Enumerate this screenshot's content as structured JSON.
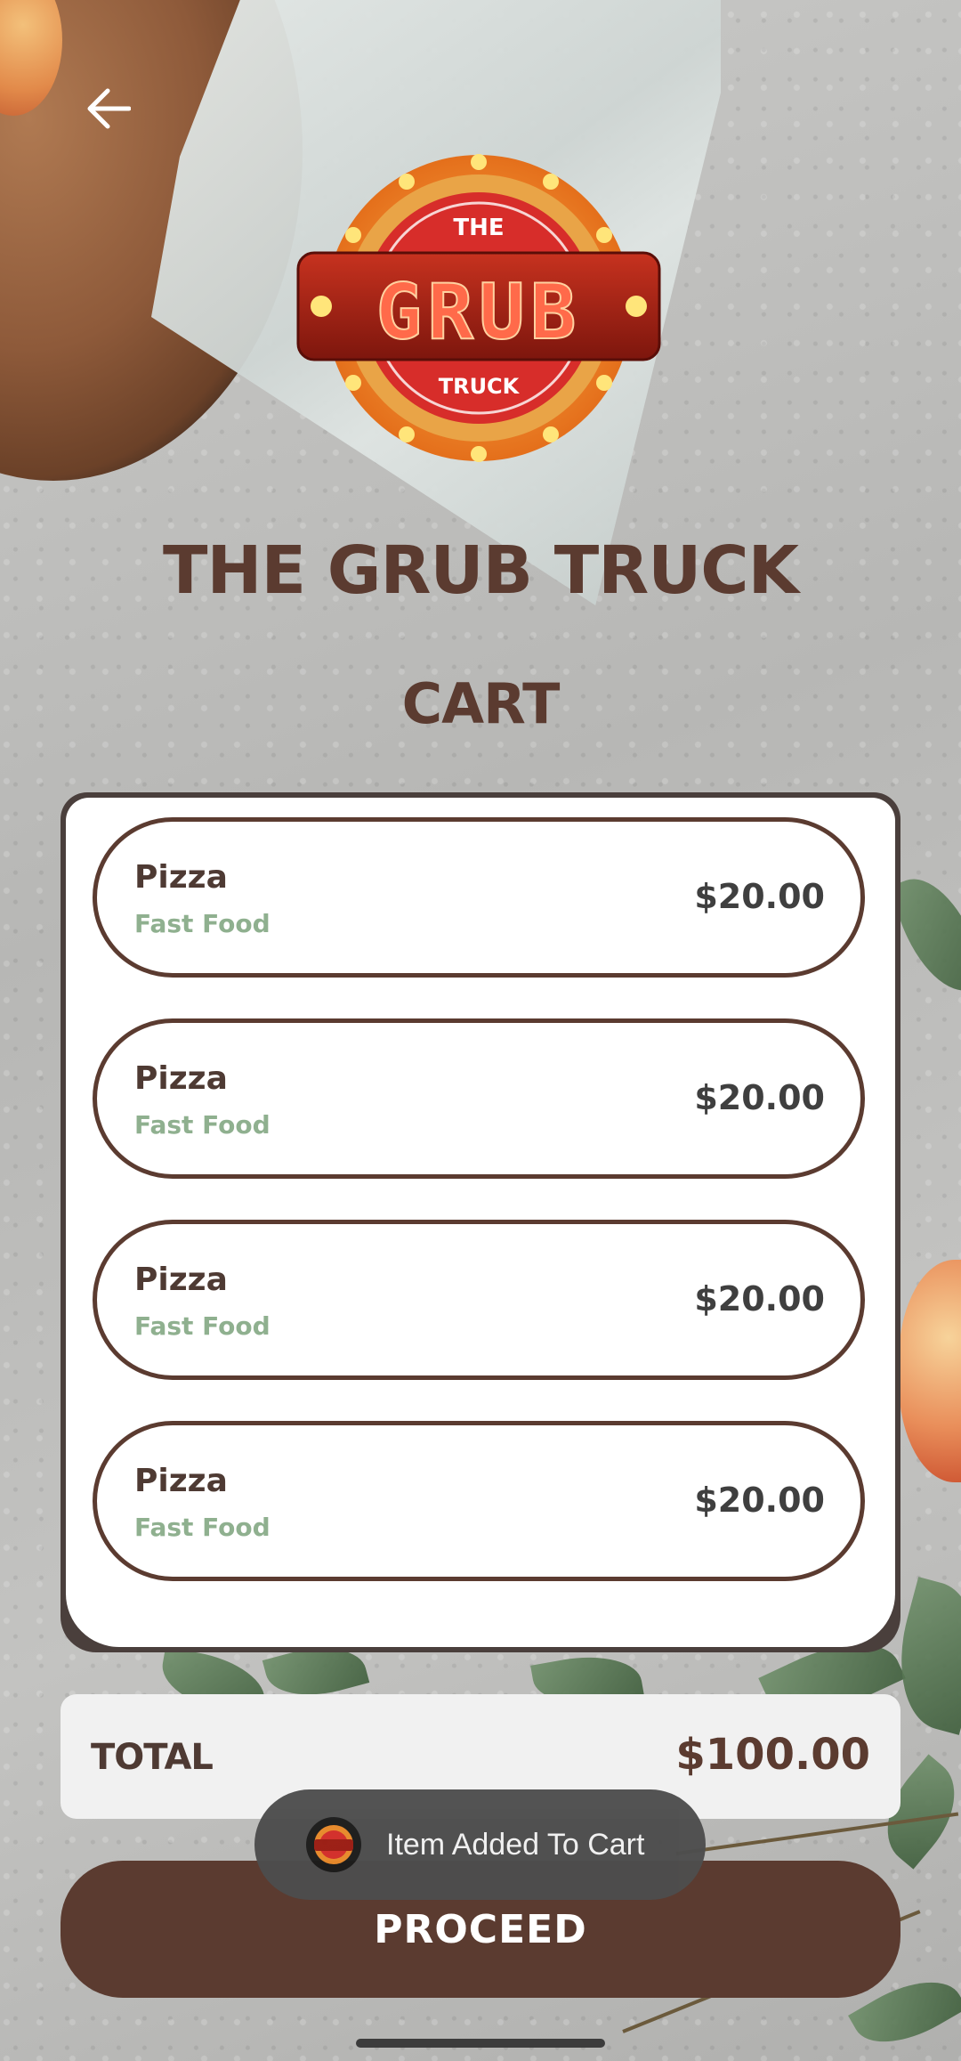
{
  "app": {
    "brand_title": "THE GRUB TRUCK",
    "page_title": "CART",
    "logo_text": {
      "top": "THE",
      "main": "GRUB",
      "bottom": "TRUCK"
    }
  },
  "cart": {
    "items": [
      {
        "name": "Pizza",
        "category": "Fast Food",
        "price": "$20.00"
      },
      {
        "name": "Pizza",
        "category": "Fast Food",
        "price": "$20.00"
      },
      {
        "name": "Pizza",
        "category": "Fast Food",
        "price": "$20.00"
      },
      {
        "name": "Pizza",
        "category": "Fast Food",
        "price": "$20.00"
      }
    ]
  },
  "total": {
    "label": "TOTAL",
    "value": "$100.00"
  },
  "actions": {
    "proceed_label": "PROCEED"
  },
  "toast": {
    "message": "Item Added To Cart"
  },
  "icons": {
    "back": "arrow-left-icon"
  },
  "colors": {
    "brown": "#5b3b30",
    "category_green": "#8fb08f",
    "panel_dark": "#4a3f3c"
  }
}
